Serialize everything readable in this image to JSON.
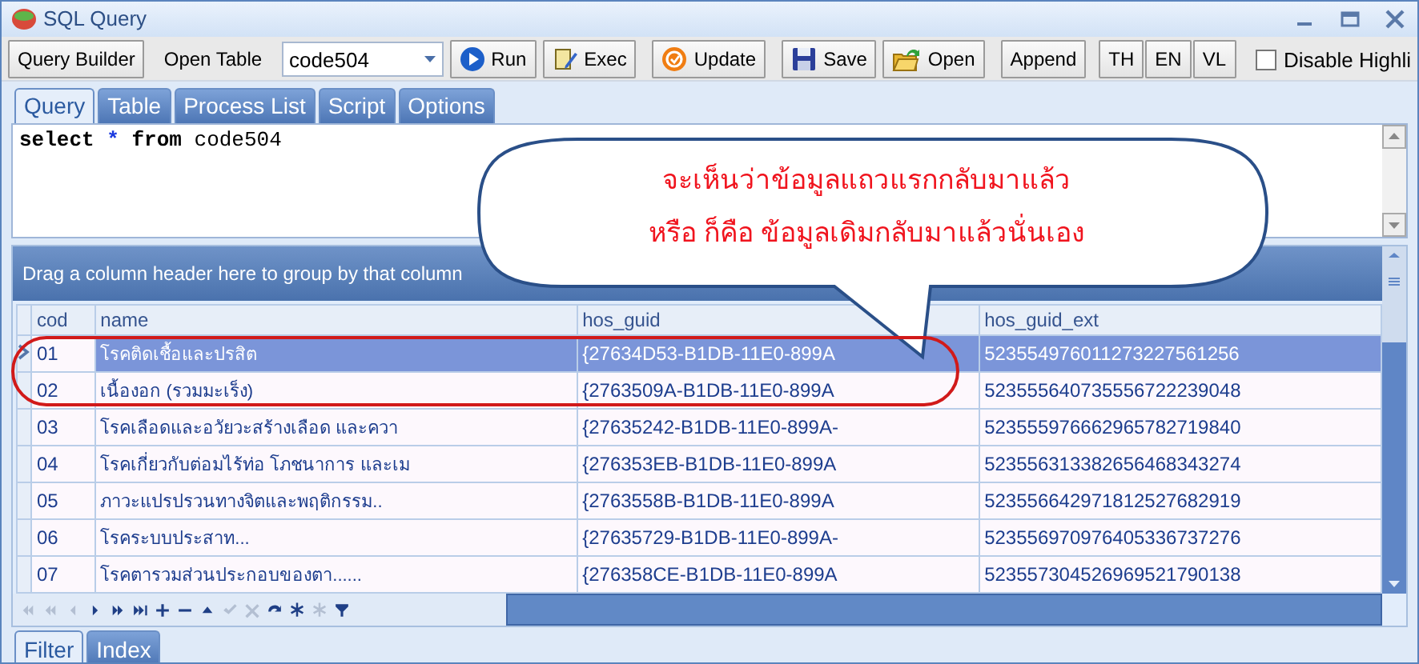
{
  "window": {
    "title": "SQL Query"
  },
  "toolbar": {
    "query_builder": "Query Builder",
    "open_table_label": "Open Table",
    "table_combo": {
      "value": "code504"
    },
    "action_buttons": [
      "Run",
      "Exec",
      "Update",
      "Save",
      "Open"
    ],
    "append": "Append",
    "language_buttons": [
      "TH",
      "EN",
      "VL"
    ],
    "disable_highlight": {
      "label": "Disable Highli",
      "checked": false
    }
  },
  "tabs": [
    {
      "label": "Query",
      "selected": true
    },
    {
      "label": "Table",
      "selected": false
    },
    {
      "label": "Process List",
      "selected": false
    },
    {
      "label": "Script",
      "selected": false
    },
    {
      "label": "Options",
      "selected": false
    }
  ],
  "editor": {
    "value": [
      {
        "text": "select",
        "kind": "keyword"
      },
      {
        "text": "*",
        "kind": "operator"
      },
      {
        "text": "from",
        "kind": "keyword"
      },
      {
        "text": "code504",
        "kind": "plain"
      }
    ]
  },
  "callout": {
    "lines": [
      "จะเห็นว่าข้อมูลแถวแรกกลับมาแล้ว",
      "หรือ ก็คือ ข้อมูลเดิมกลับมาแล้วนั่นเอง"
    ]
  },
  "grid": {
    "group_hint": "Drag a column header here to group by that column",
    "columns": [
      "cod",
      "name",
      "hos_guid",
      "hos_guid_ext"
    ],
    "rows": [
      {
        "cells": [
          "01",
          "โรคติดเชื้อและปรสิต",
          "{27634D53-B1DB-11E0-899A",
          "523554976011273227561256"
        ],
        "selected": true
      },
      {
        "cells": [
          "02",
          "เนื้องอก (รวมมะเร็ง)",
          "{2763509A-B1DB-11E0-899A",
          "523555640735556722239048"
        ],
        "selected": false
      },
      {
        "cells": [
          "03",
          "โรคเลือดและอวัยวะสร้างเลือด และควา",
          "{27635242-B1DB-11E0-899A-",
          "523555976662965782719840"
        ],
        "selected": false
      },
      {
        "cells": [
          "04",
          "โรคเกี่ยวกับต่อมไร้ท่อ โภชนาการ และเม",
          "{276353EB-B1DB-11E0-899A",
          "523556313382656468343274"
        ],
        "selected": false
      },
      {
        "cells": [
          "05",
          "ภาวะแปรปรวนทางจิตและพฤติกรรม..",
          "{2763558B-B1DB-11E0-899A",
          "523556642971812527682919"
        ],
        "selected": false
      },
      {
        "cells": [
          "06",
          "โรคระบบประสาท...",
          "{27635729-B1DB-11E0-899A-",
          "523556970976405336737276"
        ],
        "selected": false
      },
      {
        "cells": [
          "07",
          "โรคตารวมส่วนประกอบของตา......",
          "{276358CE-B1DB-11E0-899A",
          "523557304526969521790138"
        ],
        "selected": false
      }
    ],
    "navigator": [
      {
        "kind": "first",
        "disabled": true
      },
      {
        "kind": "prev_page",
        "disabled": true
      },
      {
        "kind": "prev",
        "disabled": true
      },
      {
        "kind": "next",
        "disabled": false
      },
      {
        "kind": "next_page",
        "disabled": false
      },
      {
        "kind": "last",
        "disabled": false
      },
      {
        "kind": "add",
        "disabled": false
      },
      {
        "kind": "remove",
        "disabled": false
      },
      {
        "kind": "up",
        "disabled": false
      },
      {
        "kind": "confirm",
        "disabled": true
      },
      {
        "kind": "cancel",
        "disabled": true
      },
      {
        "kind": "refresh",
        "disabled": false
      },
      {
        "kind": "star",
        "disabled": false
      },
      {
        "kind": "star",
        "disabled": true
      },
      {
        "kind": "filter",
        "disabled": false
      }
    ]
  },
  "bottom_tabs": [
    {
      "label": "Filter",
      "selected": true
    },
    {
      "label": "Index",
      "selected": false
    }
  ]
}
